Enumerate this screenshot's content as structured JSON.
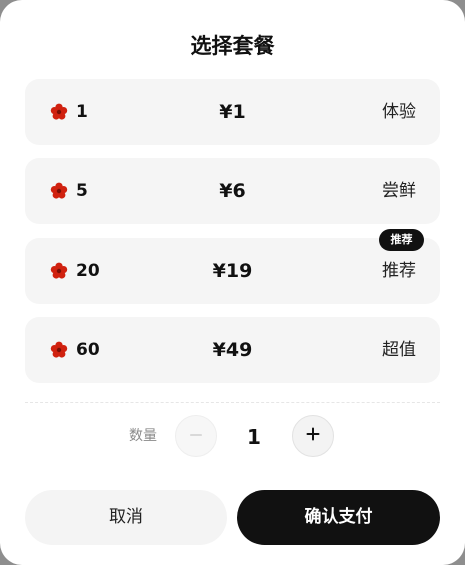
{
  "dialog": {
    "title": "选择套餐"
  },
  "options": [
    {
      "qty": "1",
      "price": "¥1",
      "tag": "体验"
    },
    {
      "qty": "5",
      "price": "¥6",
      "tag": "尝鲜"
    },
    {
      "qty": "20",
      "price": "¥19",
      "tag": "推荐",
      "badge": "推荐"
    },
    {
      "qty": "60",
      "price": "¥49",
      "tag": "超值"
    }
  ],
  "icons": {
    "flower": "flower-icon",
    "minus": "minus-icon",
    "plus": "plus-icon"
  },
  "colors": {
    "flower": "#d0210f",
    "flower_center": "#7a0f05",
    "primary_button": "#111111",
    "option_bg": "#f5f5f5"
  },
  "quantity": {
    "label": "数量",
    "value": "1"
  },
  "actions": {
    "cancel_label": "取消",
    "confirm_label": "确认支付"
  }
}
